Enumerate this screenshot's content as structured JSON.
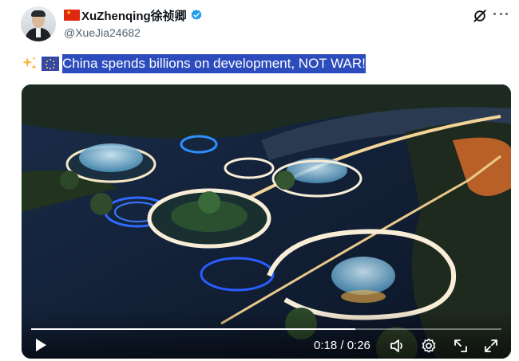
{
  "author": {
    "display_name": "XuZhenqing徐祯卿",
    "handle": "@XueJia24682",
    "verified_color": "#1d9bf0"
  },
  "tweet": {
    "text": "China spends billions on development, NOT WAR!",
    "selection_color": "#2c4bbc"
  },
  "video": {
    "current_time": "0:18",
    "duration": "0:26",
    "time_display": "0:18 / 0:26",
    "progress": 0.69
  },
  "icons": {
    "grok": "grok-icon",
    "more": "more-icon",
    "play": "play-icon",
    "volume": "volume-icon",
    "settings": "settings-icon",
    "pip": "picture-in-picture-icon",
    "fullscreen": "fullscreen-icon"
  }
}
